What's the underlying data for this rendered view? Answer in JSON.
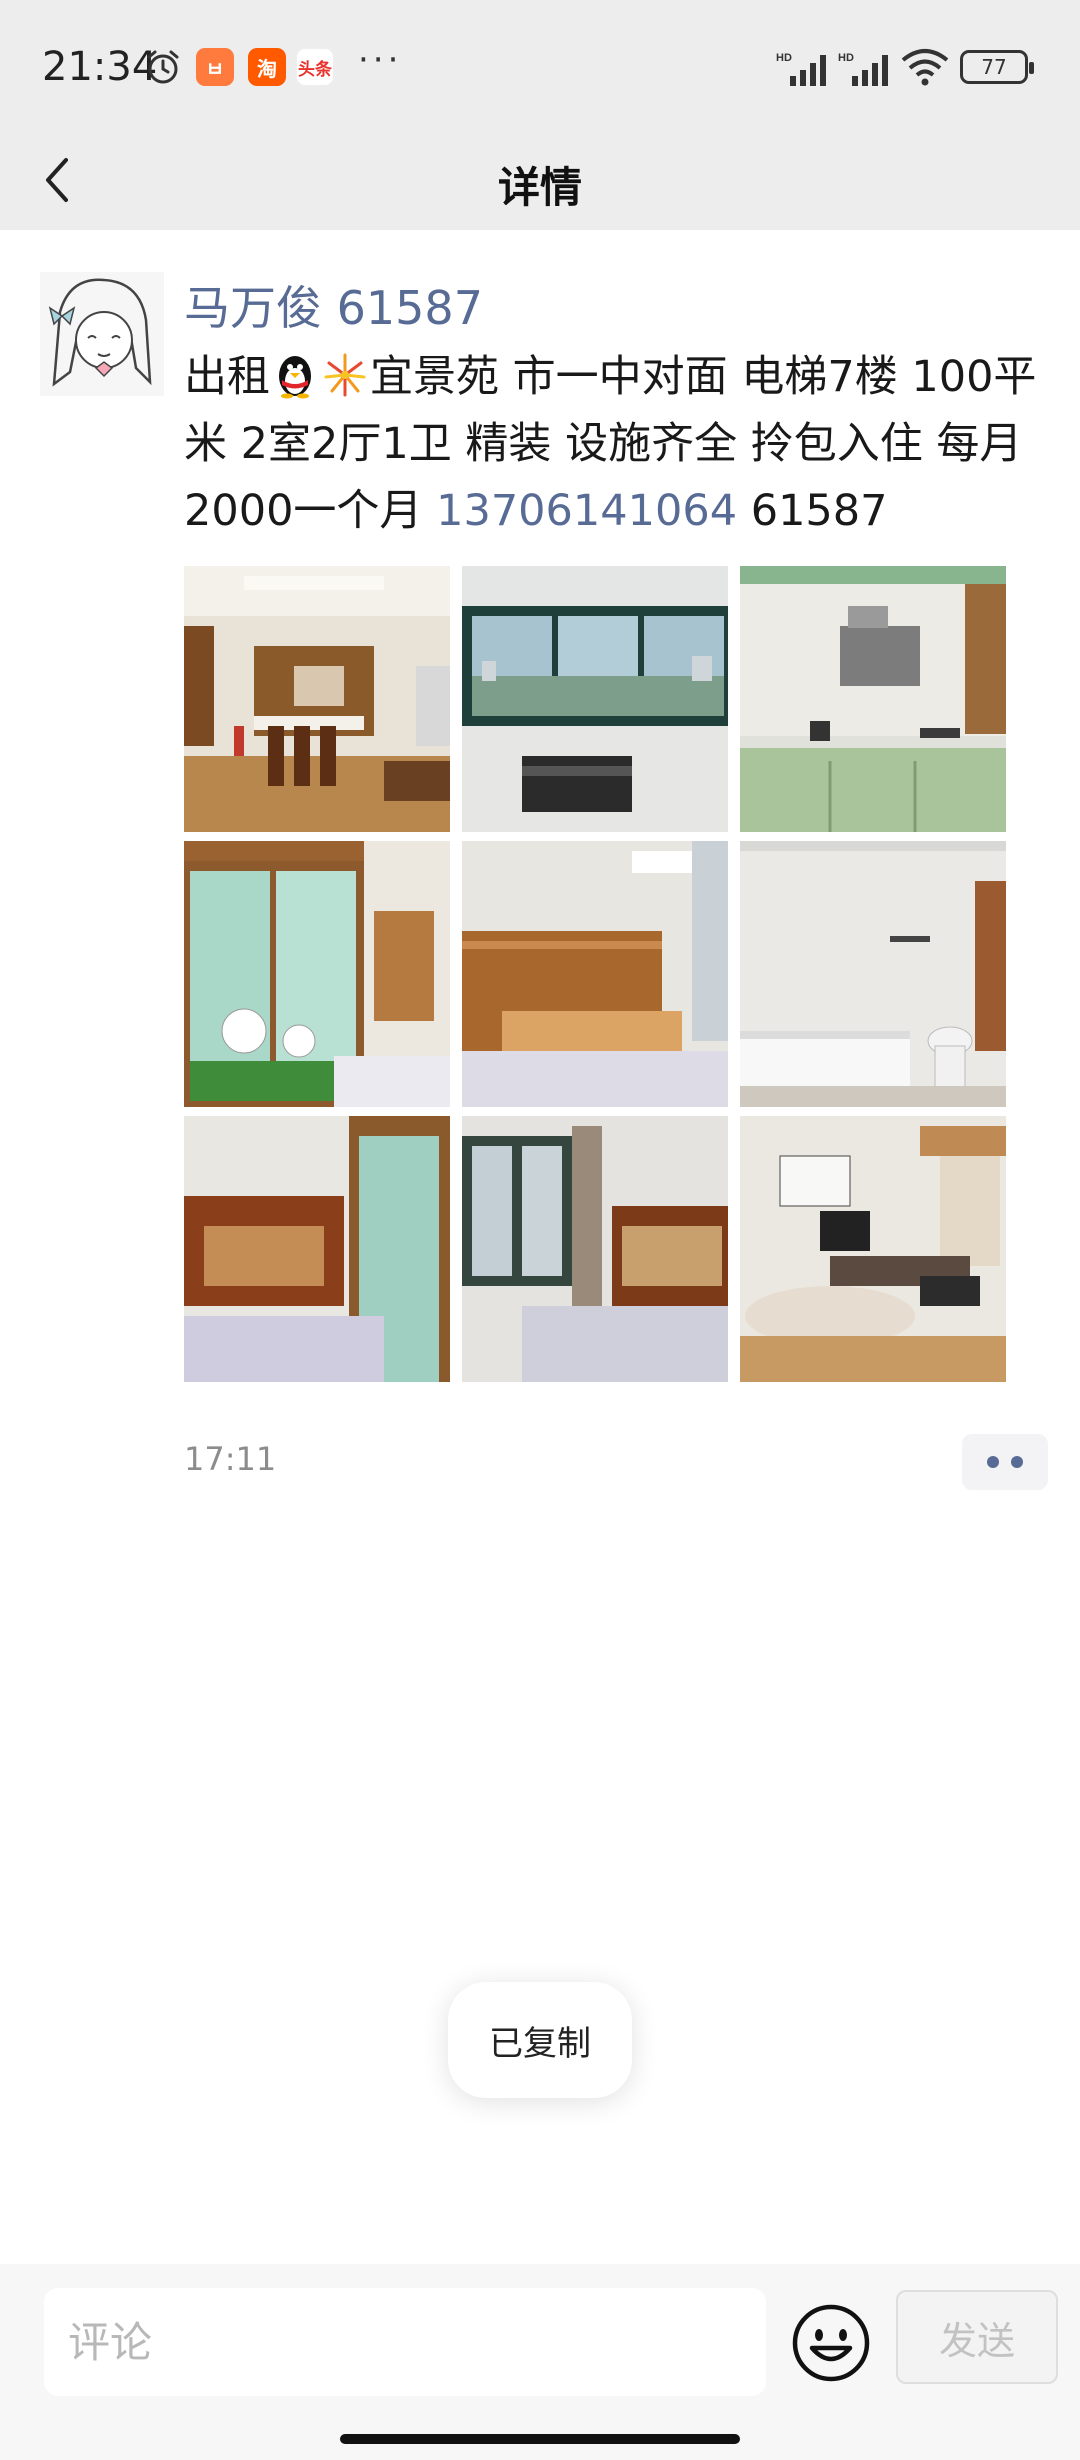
{
  "status_bar": {
    "time": "21:34",
    "apps": [
      {
        "icon": "shopping-app-icon",
        "glyph": "ㅂ"
      },
      {
        "icon": "taobao-icon",
        "glyph": "淘"
      },
      {
        "icon": "toutiao-icon",
        "glyph": "头条"
      }
    ],
    "more": "···",
    "battery": "77"
  },
  "nav": {
    "title": "详情",
    "back_icon": "back-chevron-icon"
  },
  "post": {
    "author": "马万俊 61587",
    "text_part1": "出租",
    "text_part2": "宜景苑 市一中对面 电梯7楼 100平米 2室2厅1卫 精装 设施齐全 拎包入住 每月2000一个月 ",
    "phone": "13706141064",
    "text_part3": "  61587",
    "emojis": [
      "penguin-emoji-icon",
      "fireworks-emoji-icon"
    ],
    "photos": [
      "living-dining-room-photo",
      "window-view-photo",
      "kitchen-photo",
      "bedroom-hello-kitty-wardrobe-photo",
      "bedroom-headboard-photo",
      "bathroom-bathtub-photo",
      "bedroom-wardrobe-photo",
      "bedroom-window-photo",
      "living-room-photo"
    ],
    "time": "17:11"
  },
  "toast": {
    "text": "已复制"
  },
  "comment_bar": {
    "placeholder": "评论",
    "send_label": "发送",
    "emoji_icon": "smiley-face-icon"
  },
  "colors": {
    "link": "#576b95",
    "nav_bg": "#ededed",
    "comment_bar_bg": "#f7f7f7"
  }
}
